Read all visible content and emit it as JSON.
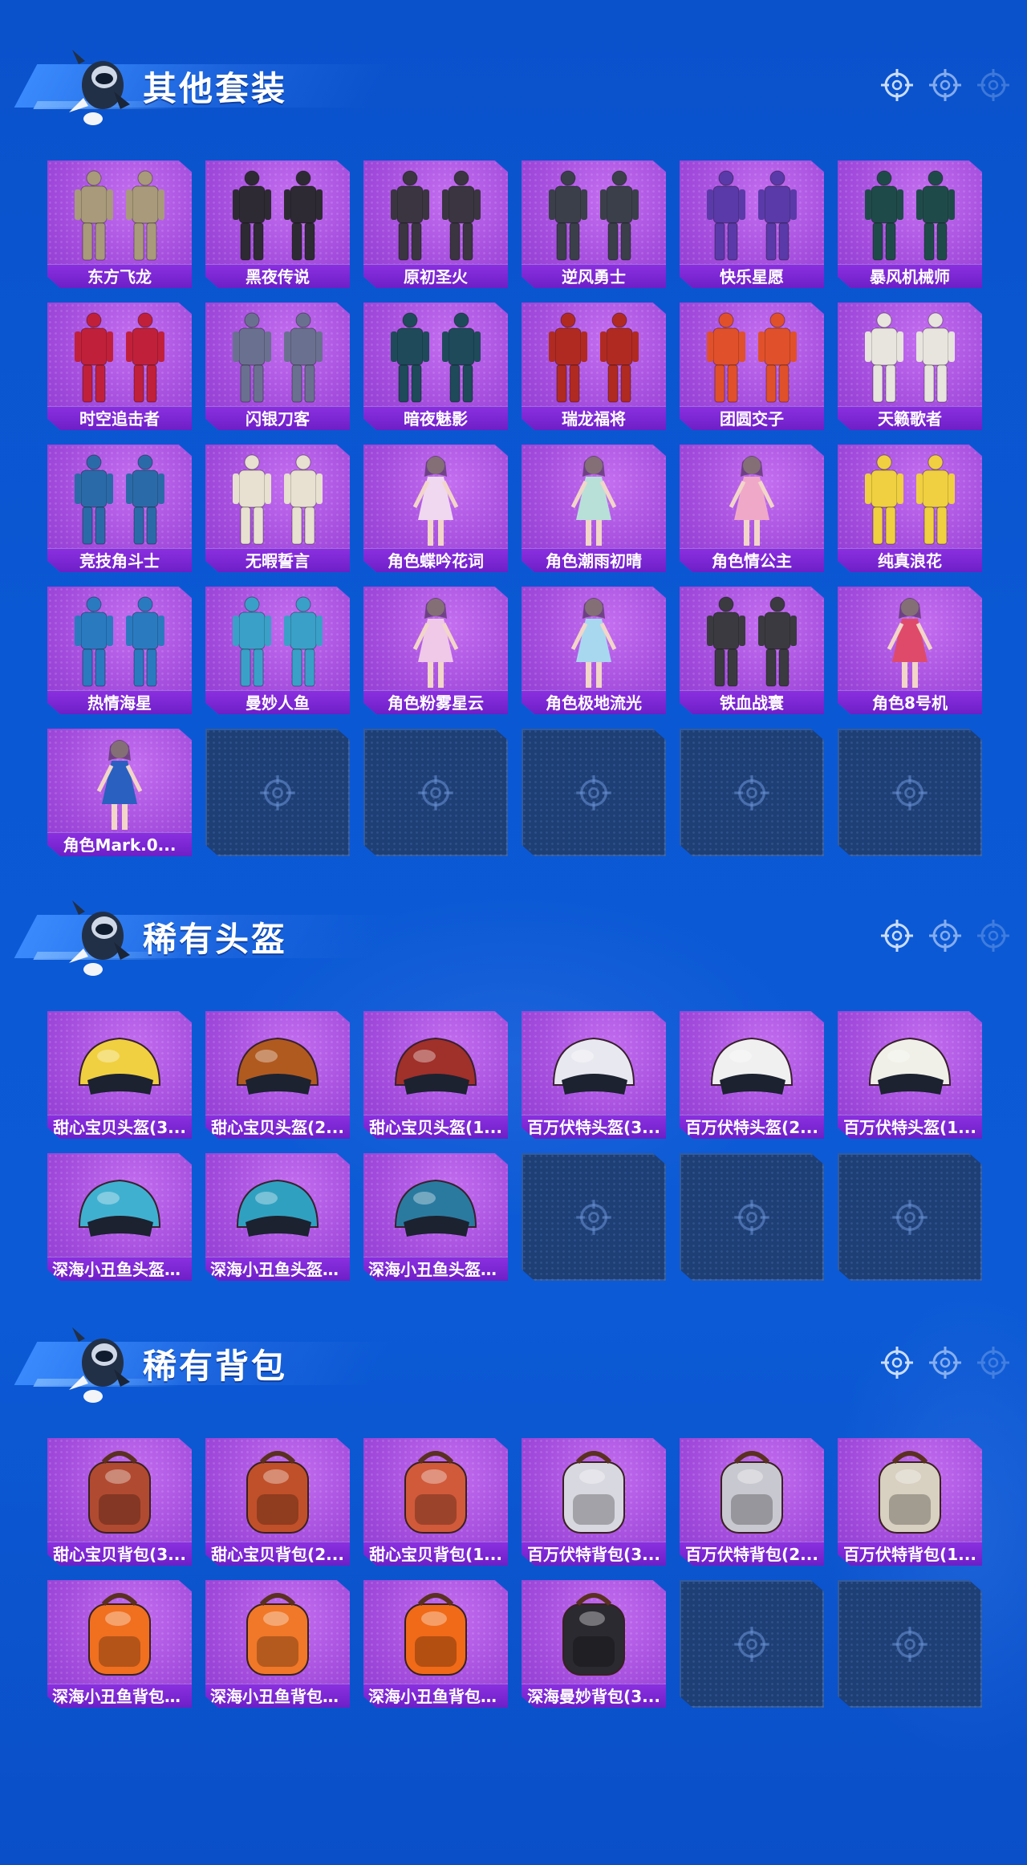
{
  "sections": [
    {
      "title": "其他套装",
      "items": [
        {
          "label": "东方飞龙",
          "art": "outfit-icon",
          "color": "#a89a7a"
        },
        {
          "label": "黑夜传说",
          "art": "outfit-icon",
          "color": "#2e2a33"
        },
        {
          "label": "原初圣火",
          "art": "outfit-icon",
          "color": "#3a3540"
        },
        {
          "label": "逆风勇士",
          "art": "outfit-icon",
          "color": "#3a3f4a"
        },
        {
          "label": "快乐星愿",
          "art": "outfit-icon",
          "color": "#5a3aa8"
        },
        {
          "label": "暴风机械师",
          "art": "outfit-icon",
          "color": "#1f4a4a"
        },
        {
          "label": "时空追击者",
          "art": "outfit-icon",
          "color": "#c0203a"
        },
        {
          "label": "闪银刀客",
          "art": "outfit-icon",
          "color": "#6a7090"
        },
        {
          "label": "暗夜魅影",
          "art": "outfit-icon",
          "color": "#1e4a5a"
        },
        {
          "label": "瑞龙福将",
          "art": "outfit-icon",
          "color": "#b02a22"
        },
        {
          "label": "团圆交子",
          "art": "outfit-icon",
          "color": "#e0502a"
        },
        {
          "label": "天籁歌者",
          "art": "outfit-icon",
          "color": "#e8e4de"
        },
        {
          "label": "竞技角斗士",
          "art": "outfit-icon",
          "color": "#2b6aa8"
        },
        {
          "label": "无暇誓言",
          "art": "outfit-icon",
          "color": "#e8e0d0"
        },
        {
          "label": "角色蝶吟花词",
          "art": "character-icon",
          "color": "#f0d8f0"
        },
        {
          "label": "角色潮雨初晴",
          "art": "character-icon",
          "color": "#b8e0d8"
        },
        {
          "label": "角色情公主",
          "art": "character-icon",
          "color": "#f0a8c8"
        },
        {
          "label": "纯真浪花",
          "art": "outfit-icon",
          "color": "#f0d040"
        },
        {
          "label": "热情海星",
          "art": "outfit-icon",
          "color": "#2a7ac0"
        },
        {
          "label": "曼妙人鱼",
          "art": "outfit-icon",
          "color": "#3aa0c8"
        },
        {
          "label": "角色粉雾星云",
          "art": "character-icon",
          "color": "#f0c8e8"
        },
        {
          "label": "角色极地流光",
          "art": "character-icon",
          "color": "#a8d8f0"
        },
        {
          "label": "铁血战寰",
          "art": "outfit-icon",
          "color": "#3a3a40"
        },
        {
          "label": "角色8号机",
          "art": "character-icon",
          "color": "#e04a6a"
        },
        {
          "label": "角色Mark.0...",
          "art": "character-icon",
          "color": "#2a60c0"
        },
        {
          "empty": true
        },
        {
          "empty": true
        },
        {
          "empty": true
        },
        {
          "empty": true
        },
        {
          "empty": true
        }
      ]
    },
    {
      "title": "稀有头盔",
      "items": [
        {
          "label": "甜心宝贝头盔(3...",
          "art": "helmet-icon",
          "color": "#f0d040"
        },
        {
          "label": "甜心宝贝头盔(2...",
          "art": "helmet-icon",
          "color": "#b05a20"
        },
        {
          "label": "甜心宝贝头盔(1...",
          "art": "helmet-icon",
          "color": "#a0302a"
        },
        {
          "label": "百万伏特头盔(3...",
          "art": "helmet-icon",
          "color": "#e8e8f0"
        },
        {
          "label": "百万伏特头盔(2...",
          "art": "helmet-icon",
          "color": "#f0f0f0"
        },
        {
          "label": "百万伏特头盔(1...",
          "art": "helmet-icon",
          "color": "#f0f0e8"
        },
        {
          "label": "深海小丑鱼头盔(...",
          "art": "helmet-icon",
          "color": "#40b0d0"
        },
        {
          "label": "深海小丑鱼头盔(...",
          "art": "helmet-icon",
          "color": "#30a0c0"
        },
        {
          "label": "深海小丑鱼头盔(...",
          "art": "helmet-icon",
          "color": "#2a7aa0"
        },
        {
          "empty": true
        },
        {
          "empty": true
        },
        {
          "empty": true
        }
      ]
    },
    {
      "title": "稀有背包",
      "items": [
        {
          "label": "甜心宝贝背包(3...",
          "art": "backpack-icon",
          "color": "#b04a30"
        },
        {
          "label": "甜心宝贝背包(2...",
          "art": "backpack-icon",
          "color": "#c0502a"
        },
        {
          "label": "甜心宝贝背包(1...",
          "art": "backpack-icon",
          "color": "#d05a3a"
        },
        {
          "label": "百万伏特背包(3...",
          "art": "backpack-icon",
          "color": "#d8d8e0"
        },
        {
          "label": "百万伏特背包(2...",
          "art": "backpack-icon",
          "color": "#c8c8d0"
        },
        {
          "label": "百万伏特背包(1...",
          "art": "backpack-icon",
          "color": "#d8d0c0"
        },
        {
          "label": "深海小丑鱼背包(...",
          "art": "backpack-icon",
          "color": "#f07020"
        },
        {
          "label": "深海小丑鱼背包(...",
          "art": "backpack-icon",
          "color": "#f07828"
        },
        {
          "label": "深海小丑鱼背包(...",
          "art": "backpack-icon",
          "color": "#f06a18"
        },
        {
          "label": "深海曼妙背包(3...",
          "art": "backpack-icon",
          "color": "#2a2a30"
        },
        {
          "empty": true
        },
        {
          "empty": true
        }
      ]
    }
  ]
}
